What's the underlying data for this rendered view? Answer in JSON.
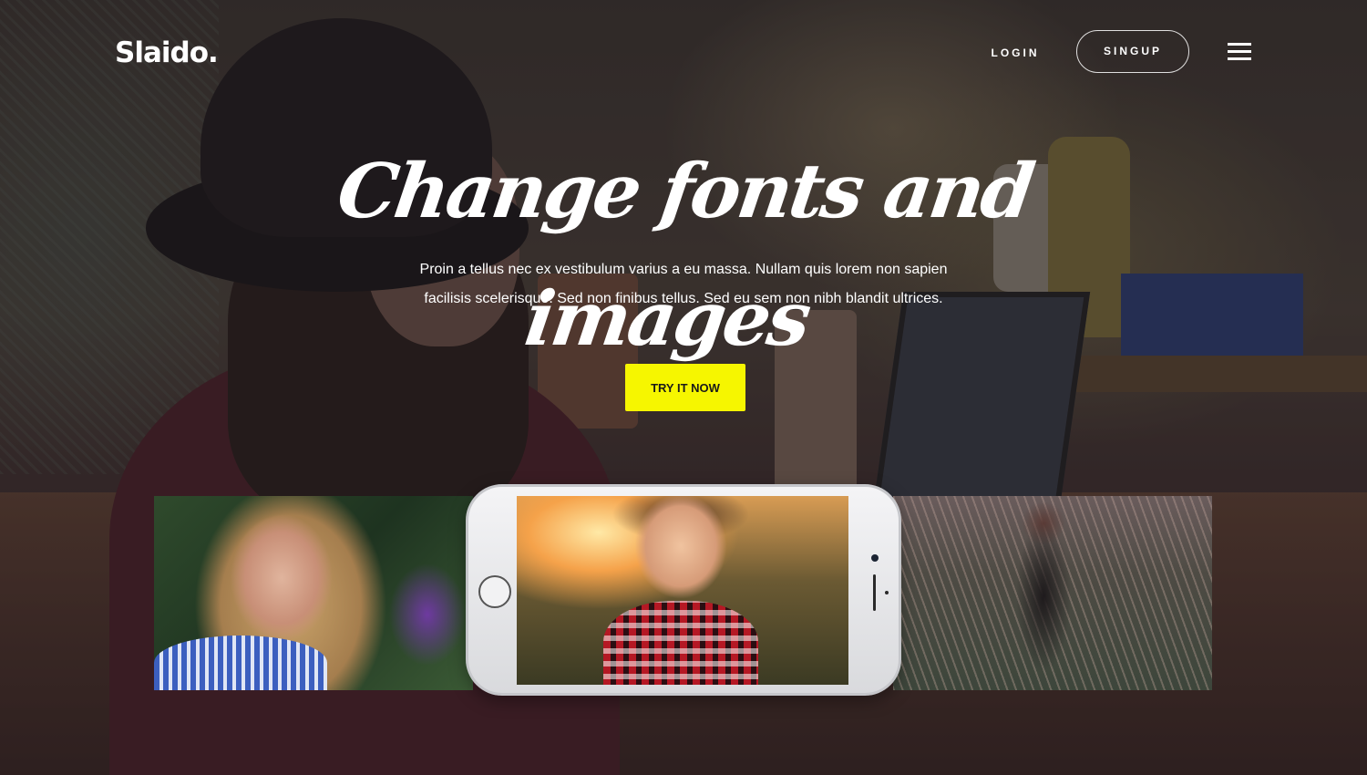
{
  "header": {
    "logo": "Slaido.",
    "login_label": "LOGIN",
    "signup_label": "SINGUP",
    "menu_icon": "hamburger-menu-icon"
  },
  "hero": {
    "title": "Change fonts and images",
    "text": "Proin a tellus nec ex vestibulum varius a eu massa. Nullam quis lorem non sapien facilisis scelerisque. Sed non finibus tellus. Sed eu sem non nibh blandit ultrices.",
    "cta_label": "TRY IT NOW"
  },
  "colors": {
    "accent": "#f6f600",
    "text": "#ffffff"
  }
}
